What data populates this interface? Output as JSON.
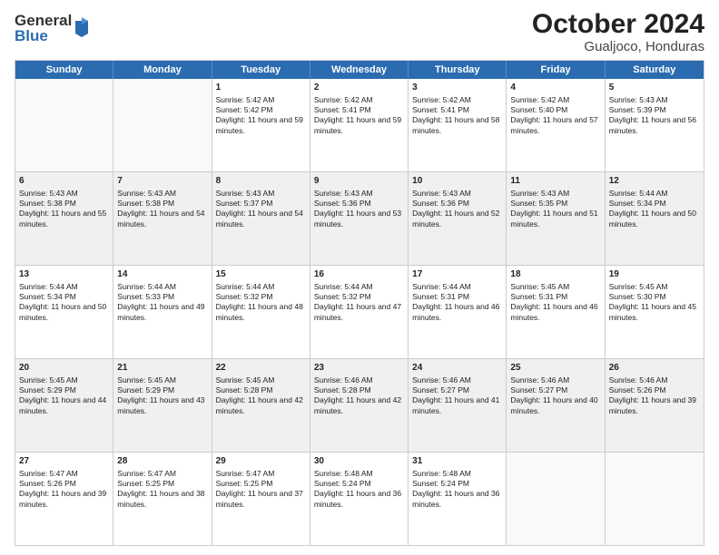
{
  "logo": {
    "general": "General",
    "blue": "Blue"
  },
  "title": "October 2024",
  "location": "Gualjoco, Honduras",
  "days": [
    "Sunday",
    "Monday",
    "Tuesday",
    "Wednesday",
    "Thursday",
    "Friday",
    "Saturday"
  ],
  "rows": [
    [
      {
        "day": "",
        "content": "",
        "empty": true
      },
      {
        "day": "",
        "content": "",
        "empty": true
      },
      {
        "day": "1",
        "content": "Sunrise: 5:42 AM\nSunset: 5:42 PM\nDaylight: 11 hours and 59 minutes."
      },
      {
        "day": "2",
        "content": "Sunrise: 5:42 AM\nSunset: 5:41 PM\nDaylight: 11 hours and 59 minutes."
      },
      {
        "day": "3",
        "content": "Sunrise: 5:42 AM\nSunset: 5:41 PM\nDaylight: 11 hours and 58 minutes."
      },
      {
        "day": "4",
        "content": "Sunrise: 5:42 AM\nSunset: 5:40 PM\nDaylight: 11 hours and 57 minutes."
      },
      {
        "day": "5",
        "content": "Sunrise: 5:43 AM\nSunset: 5:39 PM\nDaylight: 11 hours and 56 minutes."
      }
    ],
    [
      {
        "day": "6",
        "content": "Sunrise: 5:43 AM\nSunset: 5:38 PM\nDaylight: 11 hours and 55 minutes.",
        "shaded": true
      },
      {
        "day": "7",
        "content": "Sunrise: 5:43 AM\nSunset: 5:38 PM\nDaylight: 11 hours and 54 minutes.",
        "shaded": true
      },
      {
        "day": "8",
        "content": "Sunrise: 5:43 AM\nSunset: 5:37 PM\nDaylight: 11 hours and 54 minutes.",
        "shaded": true
      },
      {
        "day": "9",
        "content": "Sunrise: 5:43 AM\nSunset: 5:36 PM\nDaylight: 11 hours and 53 minutes.",
        "shaded": true
      },
      {
        "day": "10",
        "content": "Sunrise: 5:43 AM\nSunset: 5:36 PM\nDaylight: 11 hours and 52 minutes.",
        "shaded": true
      },
      {
        "day": "11",
        "content": "Sunrise: 5:43 AM\nSunset: 5:35 PM\nDaylight: 11 hours and 51 minutes.",
        "shaded": true
      },
      {
        "day": "12",
        "content": "Sunrise: 5:44 AM\nSunset: 5:34 PM\nDaylight: 11 hours and 50 minutes.",
        "shaded": true
      }
    ],
    [
      {
        "day": "13",
        "content": "Sunrise: 5:44 AM\nSunset: 5:34 PM\nDaylight: 11 hours and 50 minutes."
      },
      {
        "day": "14",
        "content": "Sunrise: 5:44 AM\nSunset: 5:33 PM\nDaylight: 11 hours and 49 minutes."
      },
      {
        "day": "15",
        "content": "Sunrise: 5:44 AM\nSunset: 5:32 PM\nDaylight: 11 hours and 48 minutes."
      },
      {
        "day": "16",
        "content": "Sunrise: 5:44 AM\nSunset: 5:32 PM\nDaylight: 11 hours and 47 minutes."
      },
      {
        "day": "17",
        "content": "Sunrise: 5:44 AM\nSunset: 5:31 PM\nDaylight: 11 hours and 46 minutes."
      },
      {
        "day": "18",
        "content": "Sunrise: 5:45 AM\nSunset: 5:31 PM\nDaylight: 11 hours and 46 minutes."
      },
      {
        "day": "19",
        "content": "Sunrise: 5:45 AM\nSunset: 5:30 PM\nDaylight: 11 hours and 45 minutes."
      }
    ],
    [
      {
        "day": "20",
        "content": "Sunrise: 5:45 AM\nSunset: 5:29 PM\nDaylight: 11 hours and 44 minutes.",
        "shaded": true
      },
      {
        "day": "21",
        "content": "Sunrise: 5:45 AM\nSunset: 5:29 PM\nDaylight: 11 hours and 43 minutes.",
        "shaded": true
      },
      {
        "day": "22",
        "content": "Sunrise: 5:45 AM\nSunset: 5:28 PM\nDaylight: 11 hours and 42 minutes.",
        "shaded": true
      },
      {
        "day": "23",
        "content": "Sunrise: 5:46 AM\nSunset: 5:28 PM\nDaylight: 11 hours and 42 minutes.",
        "shaded": true
      },
      {
        "day": "24",
        "content": "Sunrise: 5:46 AM\nSunset: 5:27 PM\nDaylight: 11 hours and 41 minutes.",
        "shaded": true
      },
      {
        "day": "25",
        "content": "Sunrise: 5:46 AM\nSunset: 5:27 PM\nDaylight: 11 hours and 40 minutes.",
        "shaded": true
      },
      {
        "day": "26",
        "content": "Sunrise: 5:46 AM\nSunset: 5:26 PM\nDaylight: 11 hours and 39 minutes.",
        "shaded": true
      }
    ],
    [
      {
        "day": "27",
        "content": "Sunrise: 5:47 AM\nSunset: 5:26 PM\nDaylight: 11 hours and 39 minutes."
      },
      {
        "day": "28",
        "content": "Sunrise: 5:47 AM\nSunset: 5:25 PM\nDaylight: 11 hours and 38 minutes."
      },
      {
        "day": "29",
        "content": "Sunrise: 5:47 AM\nSunset: 5:25 PM\nDaylight: 11 hours and 37 minutes."
      },
      {
        "day": "30",
        "content": "Sunrise: 5:48 AM\nSunset: 5:24 PM\nDaylight: 11 hours and 36 minutes."
      },
      {
        "day": "31",
        "content": "Sunrise: 5:48 AM\nSunset: 5:24 PM\nDaylight: 11 hours and 36 minutes."
      },
      {
        "day": "",
        "content": "",
        "empty": true
      },
      {
        "day": "",
        "content": "",
        "empty": true
      }
    ]
  ]
}
